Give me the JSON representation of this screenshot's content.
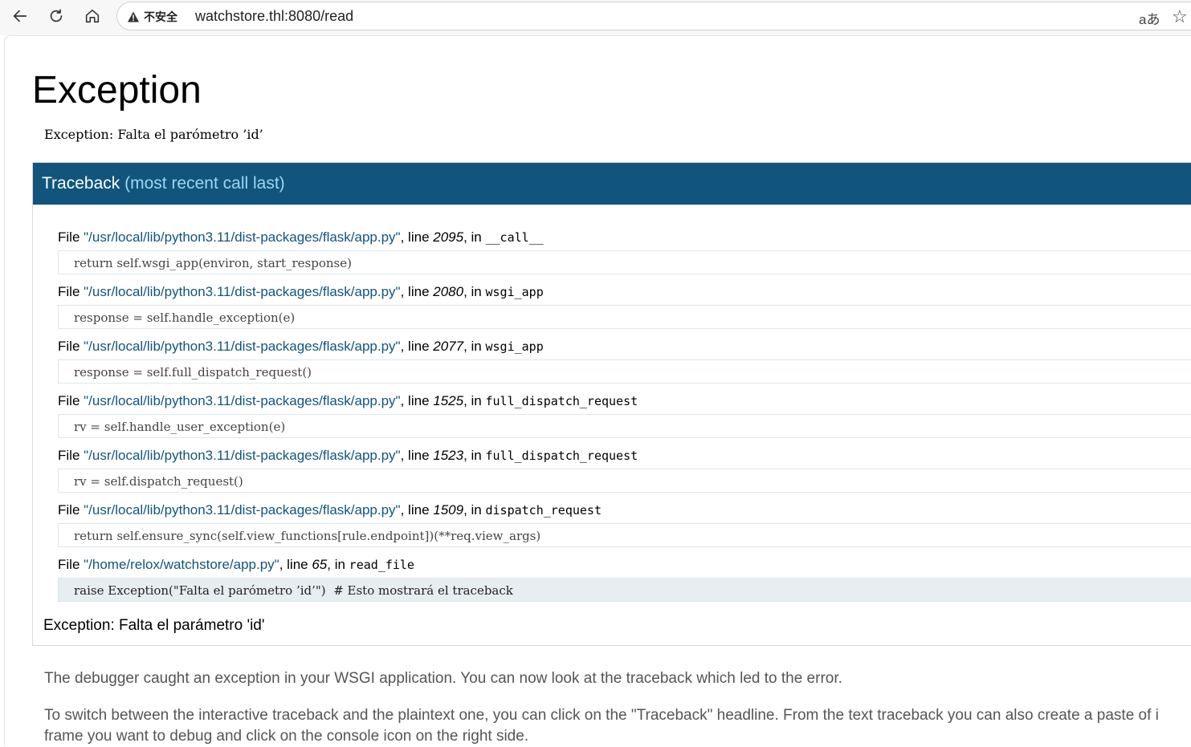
{
  "browser": {
    "insecure_label": "不安全",
    "url": "watchstore.thl:8080/read",
    "translate_glyph": "aあ",
    "star_glyph": "☆"
  },
  "page": {
    "title": "Exception",
    "error_message": "Exception: Falta el parómetro ’id’",
    "traceback_header_main": "Traceback",
    "traceback_header_sub": "(most recent call last)",
    "frames": [
      {
        "file": "\"/usr/local/lib/python3.11/dist-packages/flask/app.py\"",
        "line": "2095",
        "function": "__call__",
        "code": "return self.wsgi_app(environ, start_response)"
      },
      {
        "file": "\"/usr/local/lib/python3.11/dist-packages/flask/app.py\"",
        "line": "2080",
        "function": "wsgi_app",
        "code": "response = self.handle_exception(e)"
      },
      {
        "file": "\"/usr/local/lib/python3.11/dist-packages/flask/app.py\"",
        "line": "2077",
        "function": "wsgi_app",
        "code": "response = self.full_dispatch_request()"
      },
      {
        "file": "\"/usr/local/lib/python3.11/dist-packages/flask/app.py\"",
        "line": "1525",
        "function": "full_dispatch_request",
        "code": "rv = self.handle_user_exception(e)"
      },
      {
        "file": "\"/usr/local/lib/python3.11/dist-packages/flask/app.py\"",
        "line": "1523",
        "function": "full_dispatch_request",
        "code": "rv = self.dispatch_request()"
      },
      {
        "file": "\"/usr/local/lib/python3.11/dist-packages/flask/app.py\"",
        "line": "1509",
        "function": "dispatch_request",
        "code": "return self.ensure_sync(self.view_functions[rule.endpoint])(**req.view_args)"
      },
      {
        "file": "\"/home/relox/watchstore/app.py\"",
        "line": "65",
        "function": "read_file",
        "code": "raise Exception(\"Falta el parómetro ’id’\")  # Esto mostrará el traceback"
      }
    ],
    "labels": {
      "file": "File ",
      "line": ", line ",
      "in": ", in "
    },
    "exception_summary": "Exception: Falta el parámetro 'id'",
    "explanation_1": "The debugger caught an exception in your WSGI application. You can now look at the traceback which led to the error.",
    "explanation_2_line1": "To switch between the interactive traceback and the plaintext one, you can click on the \"Traceback\" headline. From the text traceback you can also create a paste of i",
    "explanation_2_line2": "frame you want to debug and click on the console icon on the right side."
  }
}
